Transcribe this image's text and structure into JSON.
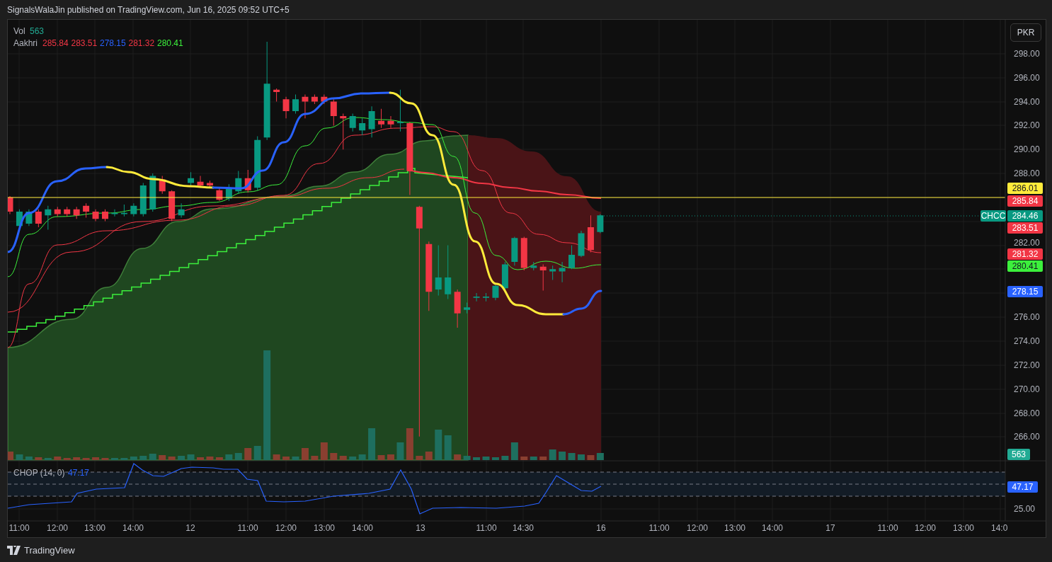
{
  "header": {
    "title": "SignalsWalaJin published on TradingView.com, Jun 16, 2025 09:52 UTC+5"
  },
  "legend": {
    "volume": {
      "label": "Vol",
      "value": "563",
      "color": "#22ab94"
    },
    "indicator": {
      "label": "Aakhri",
      "values": [
        {
          "text": "285.84",
          "color": "#f23645"
        },
        {
          "text": "283.51",
          "color": "#f23645"
        },
        {
          "text": "278.15",
          "color": "#2962ff"
        },
        {
          "text": "281.32",
          "color": "#f23645"
        },
        {
          "text": "280.41",
          "color": "#3cf03c"
        }
      ]
    }
  },
  "currency_button": "PKR",
  "price_axis": {
    "ticks": [
      "298.00",
      "296.00",
      "294.00",
      "292.00",
      "290.00",
      "288.00",
      "282.00",
      "276.00",
      "274.00",
      "272.00",
      "270.00",
      "268.00",
      "266.00"
    ],
    "markers": [
      {
        "text": "286.01",
        "color": "#ffeb3b"
      },
      {
        "text": "285.84",
        "color": "#f23645"
      },
      {
        "text": "284.46",
        "color": "#089981"
      },
      {
        "text": "283.51",
        "color": "#f23645"
      },
      {
        "text": "281.32",
        "color": "#f23645"
      },
      {
        "text": "280.41",
        "color": "#3cf03c"
      },
      {
        "text": "278.15",
        "color": "#2962ff"
      }
    ]
  },
  "symbol_label": "CHCC",
  "volume_marker": "563",
  "chop": {
    "label": "CHOP (14, 0)",
    "value": "47.17",
    "axis_tick": "25.00",
    "marker": "47.17"
  },
  "time_axis": {
    "labels": [
      "11:00",
      "12:00",
      "13:00",
      "14:00",
      "12",
      "11:00",
      "12:00",
      "13:00",
      "14:00",
      "13",
      "11:00",
      "14:30",
      "16",
      "11:00",
      "12:00",
      "13:00",
      "14:00",
      "17",
      "11:00",
      "12:00",
      "13:00",
      "14:0"
    ]
  },
  "footer": {
    "brand": "TradingView"
  }
}
